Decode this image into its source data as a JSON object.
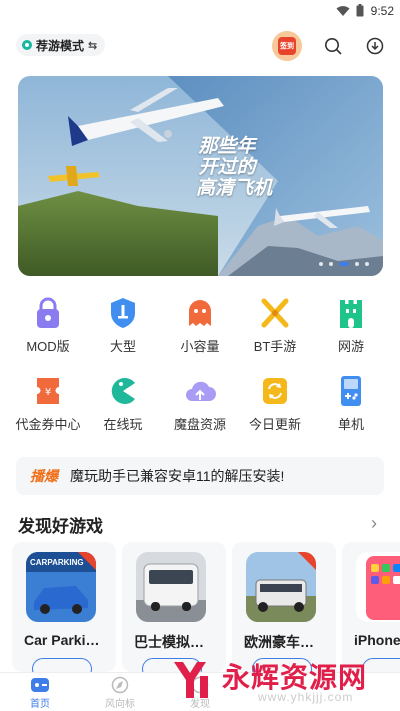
{
  "status_bar": {
    "time": "9:52"
  },
  "header": {
    "mode_label": "荐游模式",
    "swap_glyph": "⇆",
    "badge_text": "签到",
    "search_icon": "search-icon",
    "download_icon": "download-icon"
  },
  "banner": {
    "title_lines": [
      "那些年",
      "开过的",
      "高清飞机"
    ],
    "active_dot": 3,
    "dot_count": 5
  },
  "categories": [
    {
      "label": "MOD版",
      "icon": "mod-lock-icon",
      "color": "#8a7cf0"
    },
    {
      "label": "大型",
      "icon": "sword-shield-icon",
      "color": "#3f8ef0"
    },
    {
      "label": "小容量",
      "icon": "ghost-icon",
      "color": "#f06a3c"
    },
    {
      "label": "BT手游",
      "icon": "crossed-swords-icon",
      "color": "#f5b81a"
    },
    {
      "label": "网游",
      "icon": "castle-icon",
      "color": "#1fc48a"
    },
    {
      "label": "代金券中心",
      "icon": "coupon-icon",
      "color": "#f06a3c"
    },
    {
      "label": "在线玩",
      "icon": "pacman-icon",
      "color": "#1fb89a"
    },
    {
      "label": "魔盘资源",
      "icon": "cloud-upload-icon",
      "color": "#8a7cf0"
    },
    {
      "label": "今日更新",
      "icon": "refresh-icon",
      "color": "#f5b81a"
    },
    {
      "label": "单机",
      "icon": "gameboy-icon",
      "color": "#3f8ef0"
    }
  ],
  "notice": {
    "tag": "播爆",
    "text": "魔玩助手已兼容安卓11的解压安装!"
  },
  "section": {
    "title": "发现好游戏",
    "more": "›"
  },
  "games": [
    {
      "name": "Car Parki…"
    },
    {
      "name": "巴士模拟…"
    },
    {
      "name": "欧洲豪车…"
    },
    {
      "name": "iPhone"
    }
  ],
  "tabs": [
    {
      "label": "首页",
      "active": true
    },
    {
      "label": "风向标",
      "active": false
    },
    {
      "label": "发现",
      "active": false
    }
  ],
  "watermark": {
    "text": "永辉资源网",
    "url": "www.yhkjjj.com"
  },
  "colors": {
    "accent": "#3f7ee8",
    "notice_tag": "#f0701a",
    "watermark": "#e0204a"
  }
}
